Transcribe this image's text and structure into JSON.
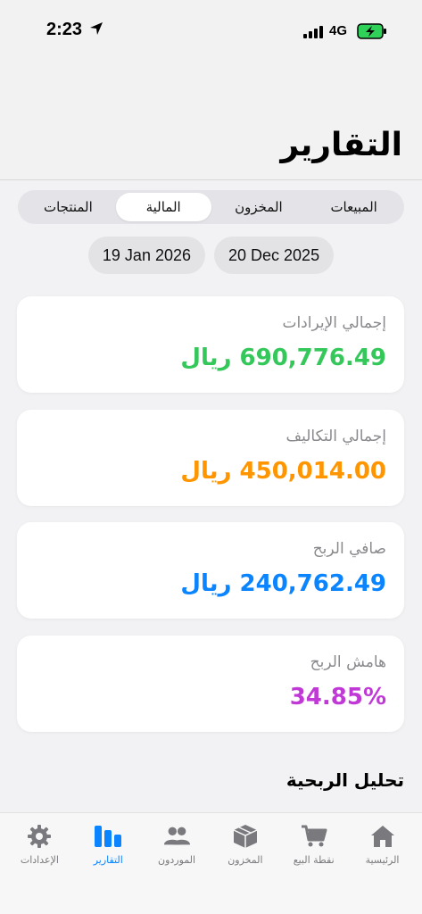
{
  "status": {
    "time": "2:23",
    "network": "4G"
  },
  "header": {
    "title": "التقارير"
  },
  "segments": [
    {
      "label": "المبيعات"
    },
    {
      "label": "المخزون"
    },
    {
      "label": "المالية"
    },
    {
      "label": "المنتجات"
    }
  ],
  "dates": {
    "start": "20 Dec 2025",
    "end": "19 Jan 2026"
  },
  "cards": [
    {
      "label": "إجمالي الإيرادات",
      "value": "690,776.49 ريال",
      "color": "#34c759"
    },
    {
      "label": "إجمالي التكاليف",
      "value": "450,014.00 ريال",
      "color": "#ff9500"
    },
    {
      "label": "صافي الربح",
      "value": "240,762.49 ريال",
      "color": "#0a84ff"
    },
    {
      "label": "هامش الربح",
      "value": "34.85%",
      "color": "#c039d6"
    }
  ],
  "section": {
    "title": "تحليل الربحية"
  },
  "tabs": [
    {
      "label": "الرئيسية",
      "icon": "home-icon"
    },
    {
      "label": "نقطة البيع",
      "icon": "cart-icon"
    },
    {
      "label": "المخزون",
      "icon": "box-icon"
    },
    {
      "label": "الموردون",
      "icon": "people-icon"
    },
    {
      "label": "التقارير",
      "icon": "chart-icon"
    },
    {
      "label": "الإعدادات",
      "icon": "gear-icon"
    }
  ],
  "colors": {
    "accent": "#0a84ff",
    "inactive": "#7a7a7e"
  }
}
